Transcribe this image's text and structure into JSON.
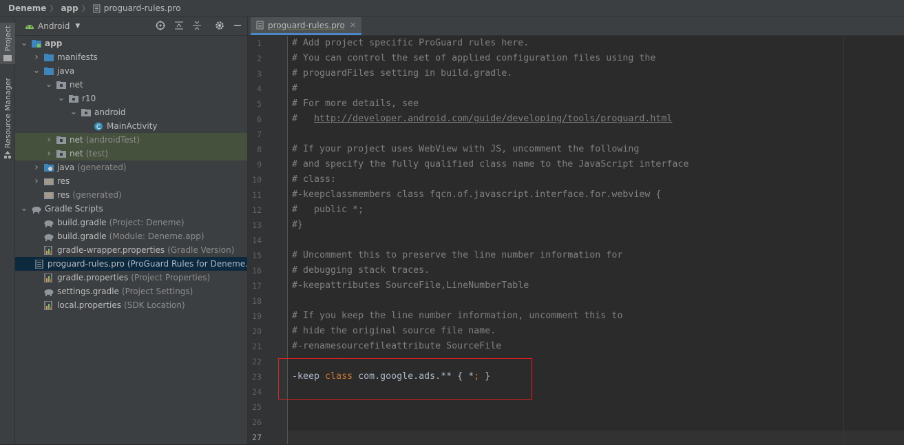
{
  "breadcrumb": {
    "project": "Deneme",
    "module": "app",
    "file": "proguard-rules.pro"
  },
  "side_stripe": {
    "project_tab": "Project",
    "resource_tab": "Resource Manager"
  },
  "project_panel": {
    "view_mode": "Android",
    "tree": [
      {
        "label": "app",
        "hint": "",
        "depth": 0,
        "icon": "module-folder-icon",
        "expanded": true
      },
      {
        "label": "manifests",
        "hint": "",
        "depth": 1,
        "icon": "folder-icon",
        "expanded": false
      },
      {
        "label": "java",
        "hint": "",
        "depth": 1,
        "icon": "folder-icon",
        "expanded": true
      },
      {
        "label": "net",
        "hint": "",
        "depth": 2,
        "icon": "package-icon",
        "expanded": true
      },
      {
        "label": "r10",
        "hint": "",
        "depth": 3,
        "icon": "package-icon",
        "expanded": true
      },
      {
        "label": "android",
        "hint": "",
        "depth": 4,
        "icon": "package-icon",
        "expanded": true
      },
      {
        "label": "MainActivity",
        "hint": "",
        "depth": 5,
        "icon": "class-icon",
        "expanded": null
      },
      {
        "label": "net",
        "hint": "(androidTest)",
        "depth": 2,
        "icon": "package-icon",
        "expanded": false
      },
      {
        "label": "net",
        "hint": "(test)",
        "depth": 2,
        "icon": "package-icon",
        "expanded": false
      },
      {
        "label": "java",
        "hint": "(generated)",
        "depth": 1,
        "icon": "generated-folder-icon",
        "expanded": false
      },
      {
        "label": "res",
        "hint": "",
        "depth": 1,
        "icon": "res-folder-icon",
        "expanded": false
      },
      {
        "label": "res",
        "hint": "(generated)",
        "depth": 1,
        "icon": "res-folder-icon",
        "expanded": null
      },
      {
        "label": "Gradle Scripts",
        "hint": "",
        "depth": 0,
        "icon": "gradle-icon",
        "expanded": true
      },
      {
        "label": "build.gradle",
        "hint": "(Project: Deneme)",
        "depth": 1,
        "icon": "gradle-icon",
        "expanded": null
      },
      {
        "label": "build.gradle",
        "hint": "(Module: Deneme.app)",
        "depth": 1,
        "icon": "gradle-icon",
        "expanded": null
      },
      {
        "label": "gradle-wrapper.properties",
        "hint": "(Gradle Version)",
        "depth": 1,
        "icon": "properties-icon",
        "expanded": null
      },
      {
        "label": "proguard-rules.pro",
        "hint": "(ProGuard Rules for Deneme.app)",
        "depth": 1,
        "icon": "text-file-icon",
        "expanded": null
      },
      {
        "label": "gradle.properties",
        "hint": "(Project Properties)",
        "depth": 1,
        "icon": "properties-icon",
        "expanded": null
      },
      {
        "label": "settings.gradle",
        "hint": "(Project Settings)",
        "depth": 1,
        "icon": "gradle-icon",
        "expanded": null
      },
      {
        "label": "local.properties",
        "hint": "(SDK Location)",
        "depth": 1,
        "icon": "properties-icon",
        "expanded": null
      }
    ]
  },
  "editor": {
    "tab_label": "proguard-rules.pro",
    "line_numbers": [
      "1",
      "2",
      "3",
      "4",
      "5",
      "6",
      "7",
      "8",
      "9",
      "10",
      "11",
      "12",
      "13",
      "14",
      "15",
      "16",
      "17",
      "18",
      "19",
      "20",
      "21",
      "22",
      "23",
      "24",
      "25",
      "26",
      "27"
    ],
    "lines": [
      "# Add project specific ProGuard rules here.",
      "# You can control the set of applied configuration files using the",
      "# proguardFiles setting in build.gradle.",
      "#",
      "# For more details, see",
      "#   ",
      "",
      "# If your project uses WebView with JS, uncomment the following",
      "# and specify the fully qualified class name to the JavaScript interface",
      "# class:",
      "#-keepclassmembers class fqcn.of.javascript.interface.for.webview {",
      "#   public *;",
      "#}",
      "",
      "# Uncomment this to preserve the line number information for",
      "# debugging stack traces.",
      "#-keepattributes SourceFile,LineNumberTable",
      "",
      "# If you keep the line number information, uncomment this to",
      "# hide the original source file name.",
      "#-renamesourcefileattribute SourceFile",
      "",
      "",
      "",
      "",
      "",
      ""
    ],
    "link_line_6": "http://developer.android.com/guide/developing/tools/proguard.html",
    "line_23": {
      "part1": "-keep ",
      "keyword": "class",
      "part2": " com.google.ads.** { *",
      "semicolon": ";",
      "part3": " }"
    }
  }
}
